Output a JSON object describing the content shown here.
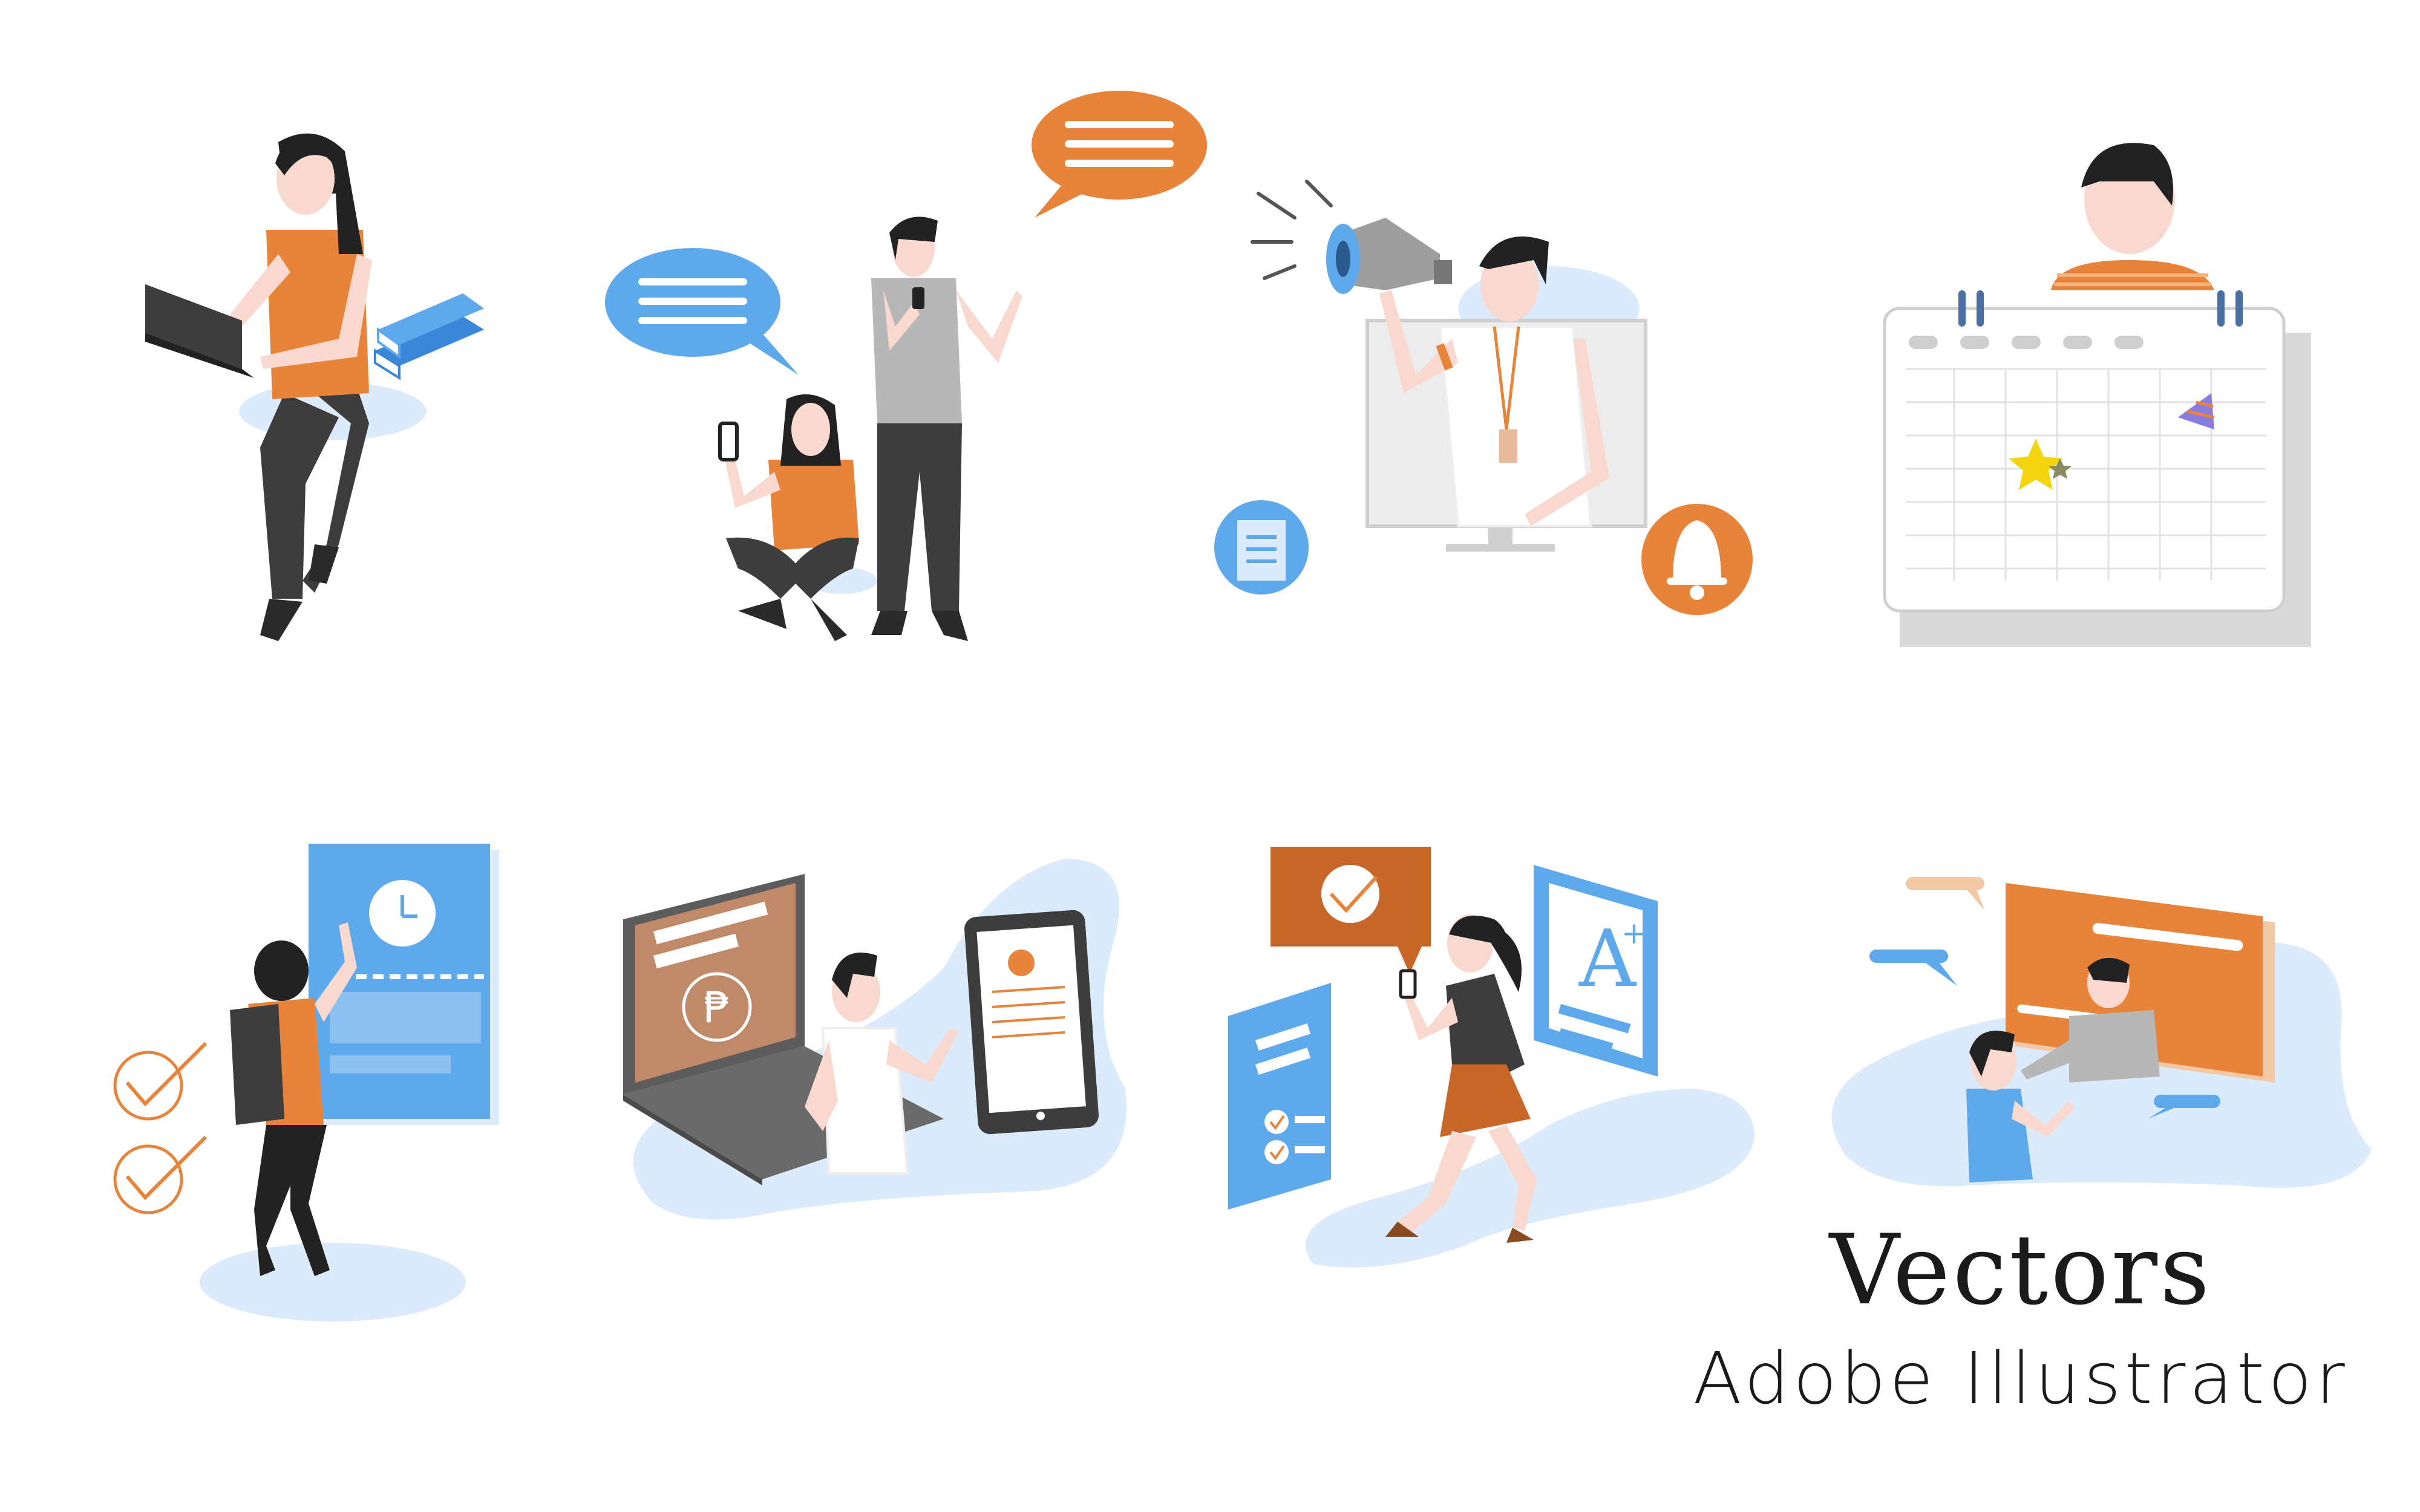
{
  "palette": {
    "orange": "#e8833a",
    "blue": "#5ea9ec",
    "light_blue": "#dcebfb",
    "dark": "#3d3d3d",
    "gray": "#c9c9c9",
    "skin": "#f9d9cf",
    "hair": "#222222"
  },
  "illustrations": [
    {
      "name": "student-with-laptop",
      "icons": [
        "laptop-icon",
        "books-icon"
      ]
    },
    {
      "name": "chat-conversation",
      "icons": [
        "speech-bubble-icon",
        "phone-icon"
      ]
    },
    {
      "name": "announcement",
      "icons": [
        "megaphone-icon",
        "document-icon",
        "bell-icon"
      ]
    },
    {
      "name": "calendar-schedule",
      "icons": [
        "calendar-icon",
        "star-icon",
        "party-hat-icon"
      ]
    },
    {
      "name": "deadline-checklist",
      "icons": [
        "clock-icon",
        "check-circle-icon"
      ]
    },
    {
      "name": "online-payment",
      "icons": [
        "peso-icon",
        "laptop-icon",
        "tablet-icon"
      ]
    },
    {
      "name": "grades-report",
      "icons": [
        "check-badge-icon",
        "a-plus-icon",
        "checklist-icon"
      ]
    },
    {
      "name": "consultation",
      "icons": [
        "whiteboard-icon",
        "speech-bubble-icon"
      ]
    }
  ],
  "caption": {
    "title": "Vectors",
    "subtitle": "Adobe Illustrator"
  }
}
